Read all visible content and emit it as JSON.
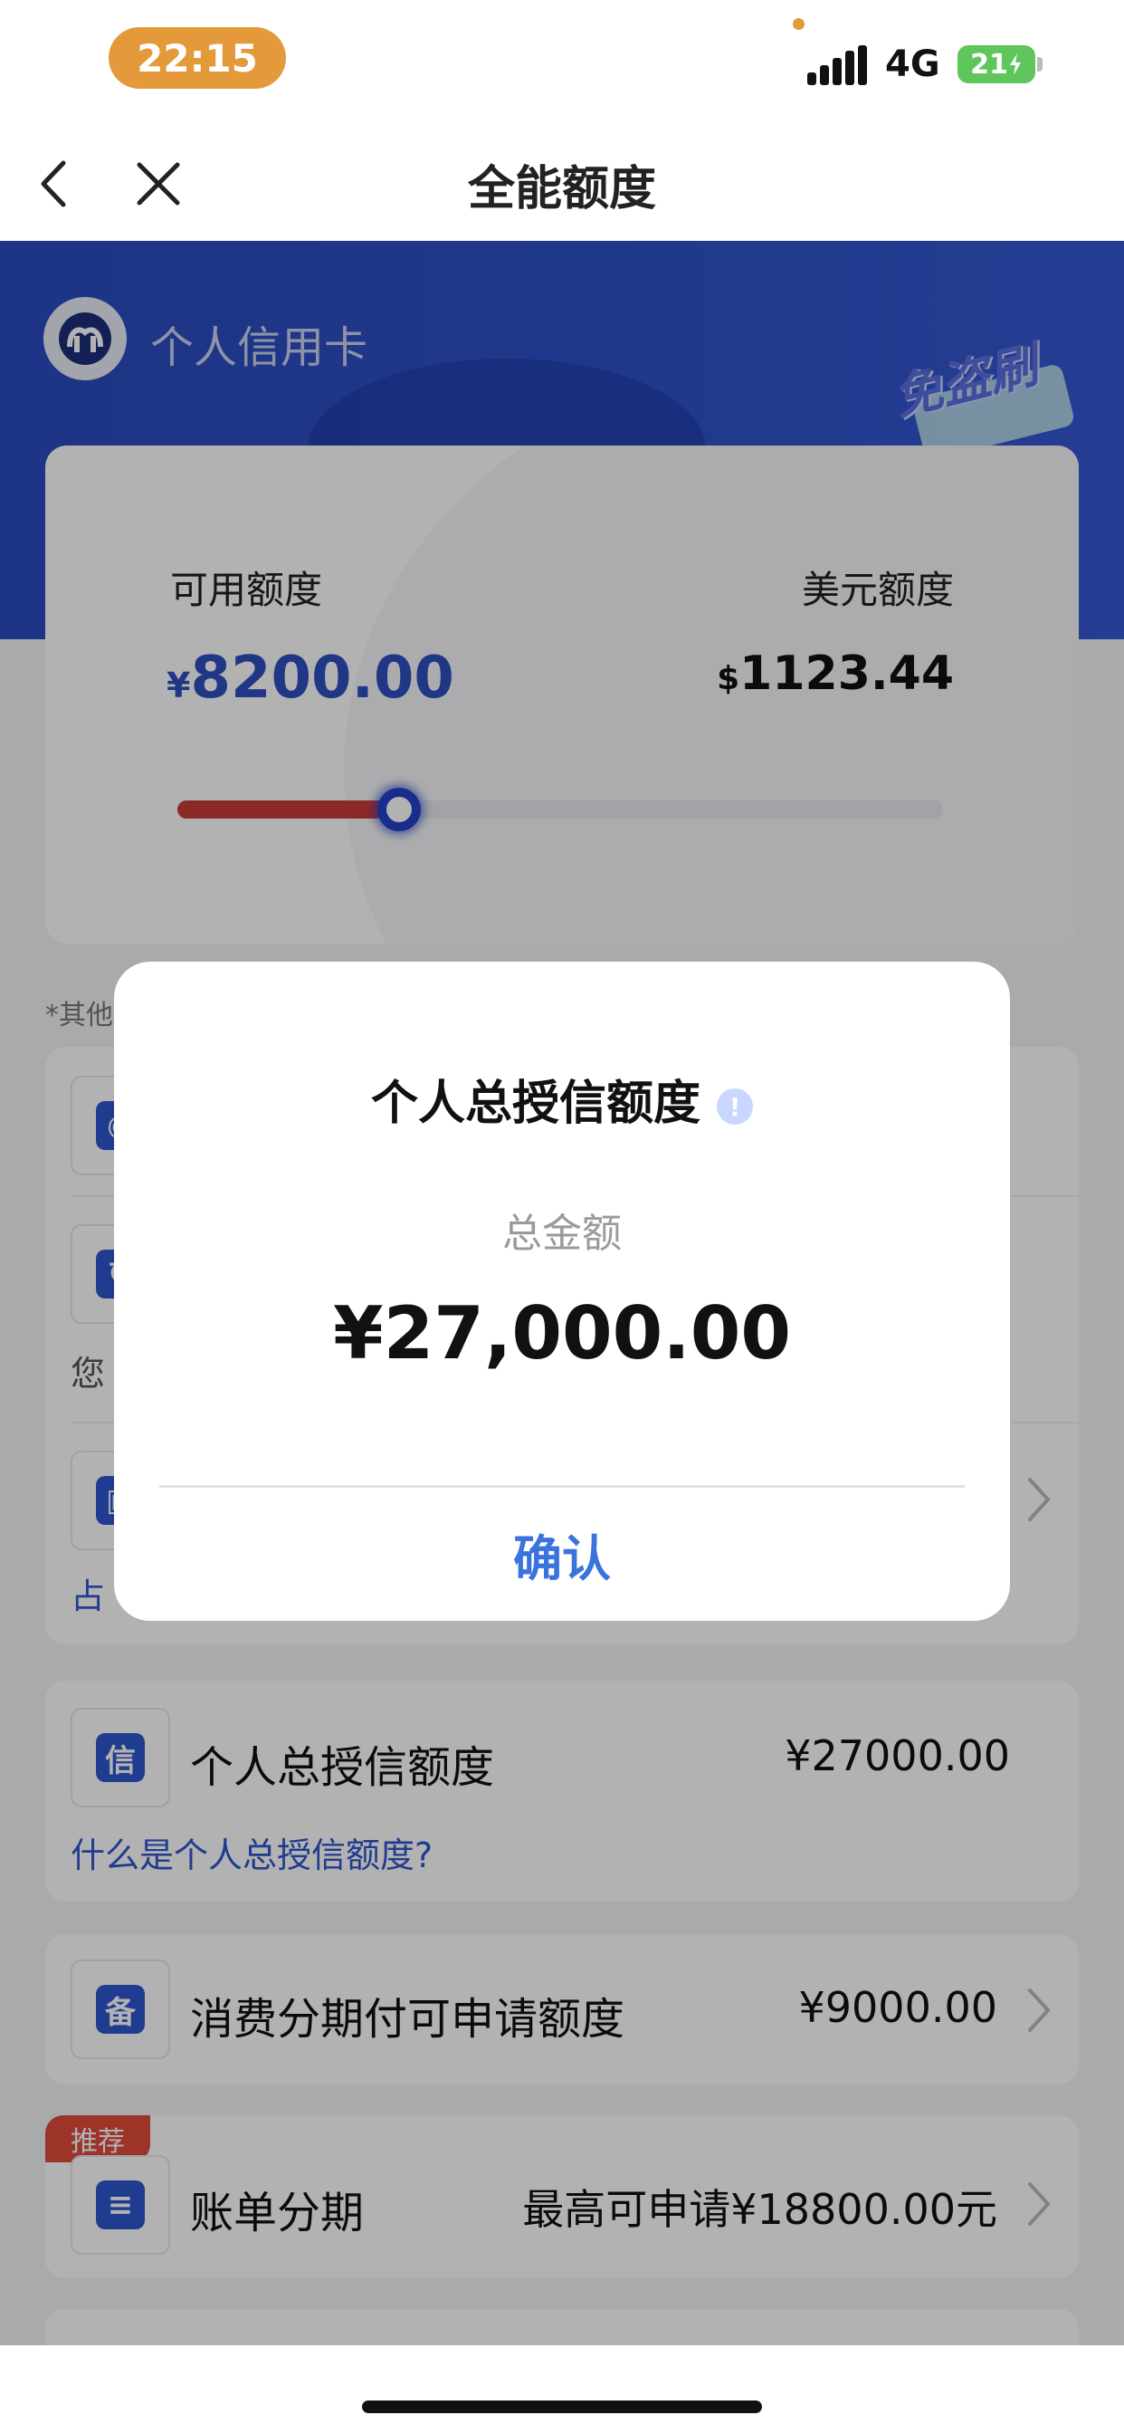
{
  "status_bar": {
    "time": "22:15",
    "network": "4G",
    "battery": "21"
  },
  "nav": {
    "title": "全能额度"
  },
  "banner": {
    "card_name": "个人信用卡",
    "badge_text": "免盗刷"
  },
  "card": {
    "available_label": "可用额度",
    "available_currency": "¥",
    "available_amount": "8200.00",
    "usd_label": "美元额度",
    "usd_currency": "$",
    "usd_amount": "1123.44",
    "used_ratio": 0.29,
    "colors": {
      "accent": "#2e4fc0",
      "slider_fill": "#c73a3a"
    }
  },
  "note": "*其他",
  "hidden_rows": {
    "text_1": "您",
    "text_2": "占"
  },
  "rows": {
    "total_credit": {
      "title": "个人总授信额度",
      "value": "¥27000.00",
      "link": "什么是个人总授信额度?",
      "icon_glyph": "信"
    },
    "installment": {
      "title": "消费分期付可申请额度",
      "value": "¥9000.00",
      "icon_glyph": "备"
    },
    "bill_installment": {
      "tag": "推荐",
      "title": "账单分期",
      "value": "最高可申请¥18800.00元"
    }
  },
  "modal": {
    "title": "个人总授信额度",
    "info_icon": "!",
    "subtitle": "总金额",
    "amount": "¥27,000.00",
    "confirm": "确认"
  }
}
